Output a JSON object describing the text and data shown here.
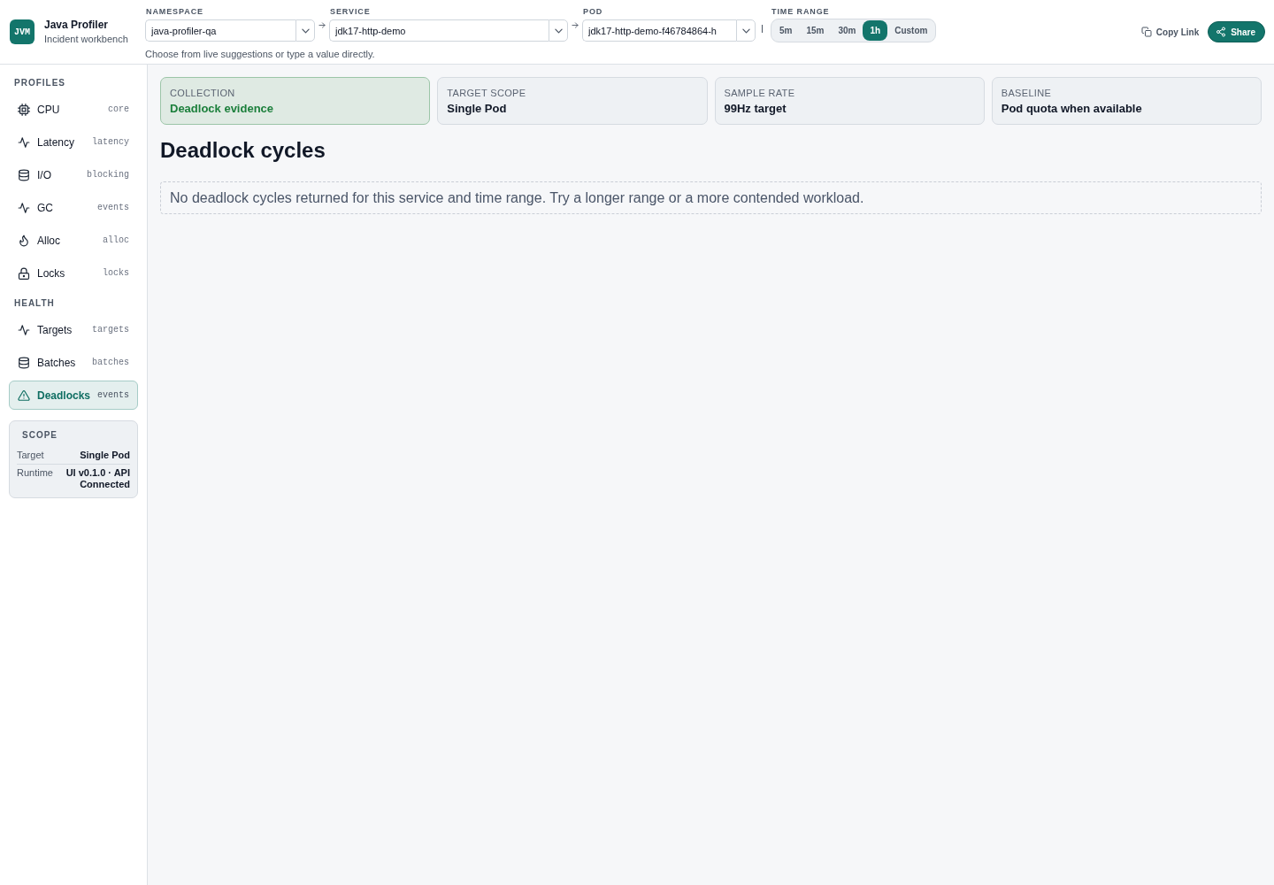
{
  "app": {
    "logo": "JVM",
    "title": "Java Profiler",
    "subtitle": "Incident workbench"
  },
  "selectors": [
    {
      "label": "NAMESPACE",
      "value": "java-profiler-qa"
    },
    {
      "label": "SERVICE",
      "value": "jdk17-http-demo"
    },
    {
      "label": "POD",
      "value": "jdk17-http-demo-f46784864-h"
    }
  ],
  "selector_hint": "Choose from live suggestions or type a value directly.",
  "time_range": {
    "label": "TIME RANGE",
    "options": [
      {
        "label": "5m",
        "selected": false
      },
      {
        "label": "15m",
        "selected": false
      },
      {
        "label": "30m",
        "selected": false
      },
      {
        "label": "1h",
        "selected": true
      },
      {
        "label": "Custom",
        "selected": false
      }
    ]
  },
  "actions": [
    {
      "kind": "copy",
      "label": "Copy Link"
    },
    {
      "kind": "share",
      "label": "Share"
    }
  ],
  "sidebar": {
    "sections": [
      {
        "title": "PROFILES",
        "items": [
          {
            "kind": "cpu",
            "label": "CPU",
            "tag": "core",
            "selected": false
          },
          {
            "kind": "pulse",
            "label": "Latency",
            "tag": "latency",
            "selected": false
          },
          {
            "kind": "storage",
            "label": "I/O",
            "tag": "blocking",
            "selected": false
          },
          {
            "kind": "pulse",
            "label": "GC",
            "tag": "events",
            "selected": false
          },
          {
            "kind": "flame",
            "label": "Alloc",
            "tag": "alloc",
            "selected": false
          },
          {
            "kind": "lock",
            "label": "Locks",
            "tag": "locks",
            "selected": false
          }
        ]
      },
      {
        "title": "HEALTH",
        "items": [
          {
            "kind": "pulse",
            "label": "Targets",
            "tag": "targets",
            "selected": false
          },
          {
            "kind": "storage",
            "label": "Batches",
            "tag": "batches",
            "selected": false
          },
          {
            "kind": "alert",
            "label": "Deadlocks",
            "tag": "events",
            "selected": true
          }
        ]
      }
    ],
    "scope": {
      "title": "SCOPE",
      "rows": [
        {
          "key": "Target",
          "value": "Single Pod"
        },
        {
          "key": "Runtime",
          "value": "UI v0.1.0 · API Connected"
        }
      ]
    }
  },
  "summary_cards": [
    {
      "label": "COLLECTION",
      "value": "Deadlock evidence",
      "highlighted": true
    },
    {
      "label": "TARGET SCOPE",
      "value": "Single Pod",
      "highlighted": false
    },
    {
      "label": "SAMPLE RATE",
      "value": "99Hz target",
      "highlighted": false
    },
    {
      "label": "BASELINE",
      "value": "Pod quota when available",
      "highlighted": false
    }
  ],
  "section": {
    "title": "Deadlock cycles",
    "empty_message": "No deadlock cycles returned for this service and time range. Try a longer range or a more contended workload."
  }
}
